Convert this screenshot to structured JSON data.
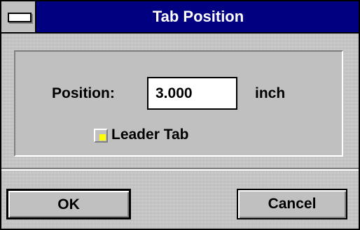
{
  "window": {
    "title": "Tab Position",
    "system_menu_icon": "system-menu-icon"
  },
  "form": {
    "position_label": "Position:",
    "position_value": "3.000",
    "unit_label": "inch",
    "leader_tab_label": "Leader Tab",
    "leader_tab_checked": false
  },
  "buttons": {
    "ok_label": "OK",
    "cancel_label": "Cancel"
  },
  "colors": {
    "titlebar": "#000080",
    "face": "#c0c0c0",
    "checkbox_accent": "#ffff00"
  }
}
